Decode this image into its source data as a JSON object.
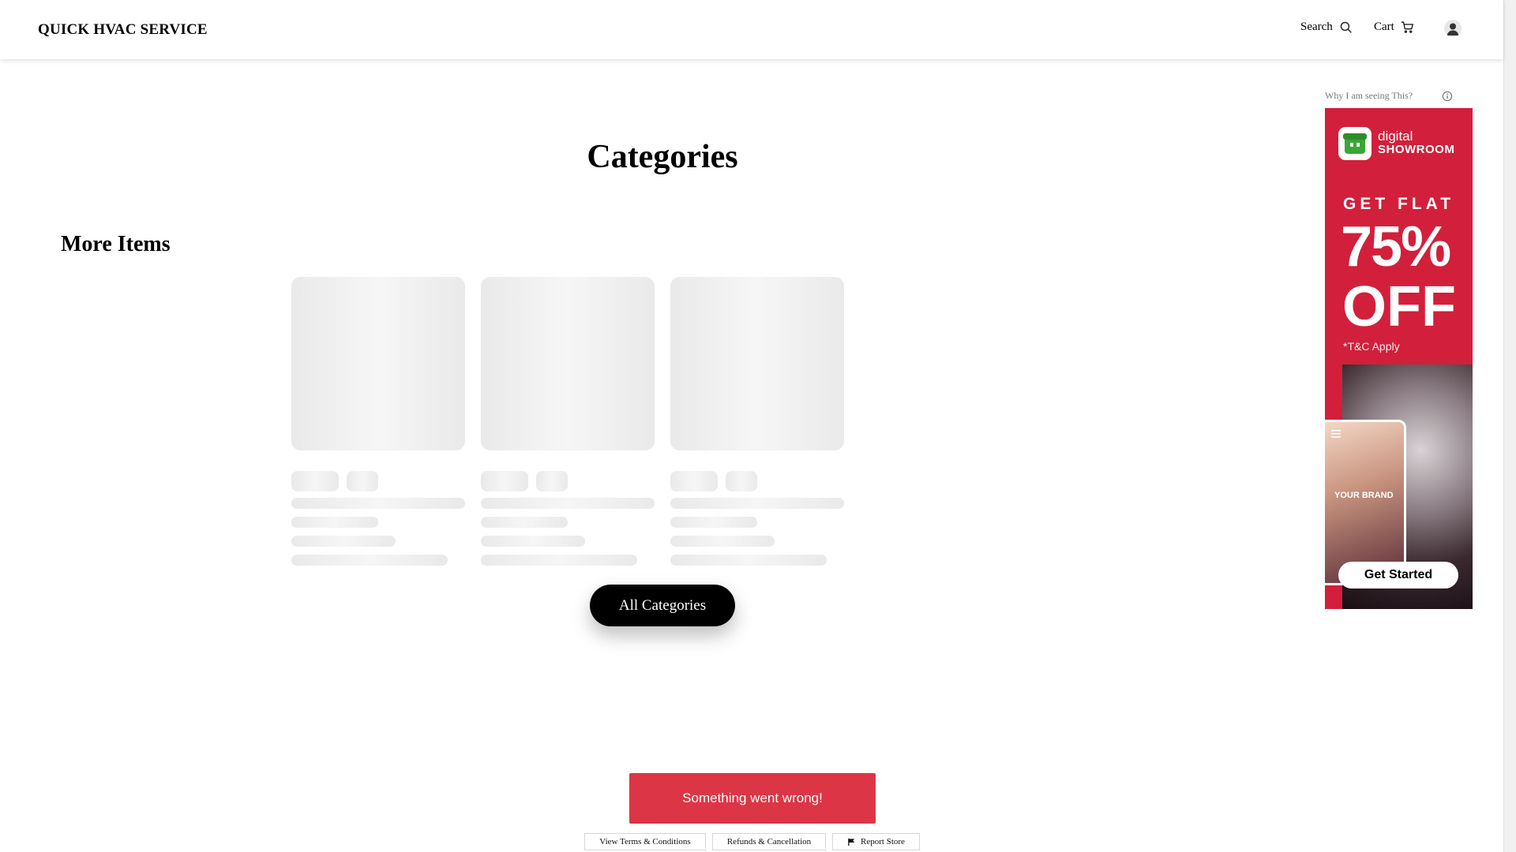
{
  "header": {
    "brand": "QUICK HVAC SERVICE",
    "search_label": "Search",
    "cart_label": "Cart"
  },
  "main": {
    "title": "Categories",
    "section_title": "More Items",
    "all_categories_button": "All Categories"
  },
  "ad": {
    "why_label": "Why I am seeing This?",
    "logo_line1": "digital",
    "logo_line2": "SHOWROOM",
    "headline": "GET FLAT",
    "discount": "75%",
    "off": "OFF",
    "terms": "*T&C Apply",
    "brand_text": "YOUR BRAND",
    "cta": "Get Started",
    "background_color": "#d21f3c"
  },
  "toast": {
    "message": "Something went wrong!",
    "color": "#dc3545"
  },
  "footer": {
    "links": [
      "View Terms & Conditions",
      "Refunds & Cancellation",
      "Report Store"
    ]
  }
}
